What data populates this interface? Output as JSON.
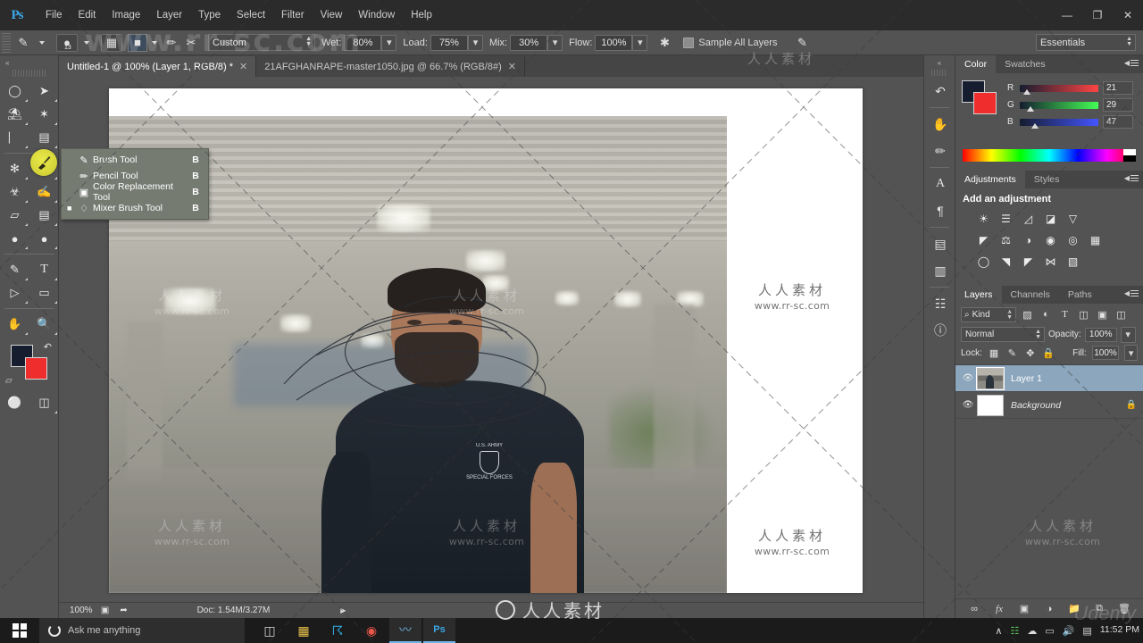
{
  "app": {
    "name": "Adobe Photoshop",
    "logo_text": "Ps",
    "workspace": "Essentials"
  },
  "menubar": {
    "items": [
      "File",
      "Edit",
      "Image",
      "Layer",
      "Type",
      "Select",
      "Filter",
      "View",
      "Window",
      "Help"
    ]
  },
  "window_controls": {
    "minimize": "—",
    "maximize": "❐",
    "close": "✕"
  },
  "options_bar": {
    "brush_size": "13",
    "preset_label": "Custom",
    "wet_label": "Wet:",
    "wet_value": "80%",
    "load_label": "Load:",
    "load_value": "75%",
    "mix_label": "Mix:",
    "mix_value": "30%",
    "flow_label": "Flow:",
    "flow_value": "100%",
    "sample_all_layers": "Sample All Layers"
  },
  "document_tabs": [
    {
      "title": "Untitled-1 @ 100% (Layer 1, RGB/8) *",
      "active": true,
      "close": "✕"
    },
    {
      "title": "21AFGHANRAPE-master1050.jpg @ 66.7% (RGB/8#)",
      "active": false,
      "close": "✕"
    }
  ],
  "tool_flyout": {
    "items": [
      {
        "label": "Brush Tool",
        "shortcut": "B",
        "selected": false
      },
      {
        "label": "Pencil Tool",
        "shortcut": "B",
        "selected": false
      },
      {
        "label": "Color Replacement Tool",
        "shortcut": "B",
        "selected": false
      },
      {
        "label": "Mixer Brush Tool",
        "shortcut": "B",
        "selected": true
      }
    ]
  },
  "toolbar": {
    "collapse": "«",
    "tools": [
      {
        "name": "elliptical-marquee-tool",
        "glyph": "◯"
      },
      {
        "name": "move-tool",
        "glyph": "➤"
      },
      {
        "name": "lasso-tool",
        "glyph": "⌇"
      },
      {
        "name": "magic-wand-tool",
        "glyph": "✦"
      },
      {
        "name": "crop-tool",
        "glyph": "⌸"
      },
      {
        "name": "eyedropper-tool",
        "glyph": "⚖"
      },
      {
        "name": "spot-healing-brush-tool",
        "glyph": "✻"
      },
      {
        "name": "brush-tool",
        "glyph": "✐"
      },
      {
        "name": "clone-stamp-tool",
        "glyph": "⛃"
      },
      {
        "name": "history-brush-tool",
        "glyph": "✎"
      },
      {
        "name": "eraser-tool",
        "glyph": "▱"
      },
      {
        "name": "gradient-tool",
        "glyph": "▤"
      },
      {
        "name": "blur-tool",
        "glyph": "●"
      },
      {
        "name": "dodge-tool",
        "glyph": "◐"
      },
      {
        "name": "pen-tool",
        "glyph": "✒"
      },
      {
        "name": "type-tool",
        "glyph": "T"
      },
      {
        "name": "path-selection-tool",
        "glyph": "➤"
      },
      {
        "name": "rectangle-tool",
        "glyph": "▭"
      },
      {
        "name": "hand-tool",
        "glyph": "✋"
      },
      {
        "name": "zoom-tool",
        "glyph": "⚲"
      }
    ],
    "foreground_color": "#151d2f",
    "background_color": "#ef2d2d",
    "quick_mask": "⊚",
    "screen_mode": "▣"
  },
  "canvas": {
    "zoom": "100%",
    "doc_info": "Doc: 1.54M/3.27M",
    "status_arrow": "▶"
  },
  "icon_rail": {
    "collapse": "«",
    "icons": [
      {
        "name": "history-panel-icon",
        "glyph": "↺"
      },
      {
        "name": "brush-presets-icon",
        "glyph": "⚒"
      },
      {
        "name": "brush-panel-icon",
        "glyph": "✏"
      },
      {
        "name": "character-panel-icon",
        "glyph": "A"
      },
      {
        "name": "paragraph-panel-icon",
        "glyph": "¶"
      },
      {
        "name": "libraries-panel-icon",
        "glyph": "▤"
      },
      {
        "name": "notes-panel-icon",
        "glyph": "▥"
      },
      {
        "name": "properties-panel-icon",
        "glyph": "☷"
      },
      {
        "name": "info-panel-icon",
        "glyph": "ⓘ"
      }
    ]
  },
  "color_panel": {
    "tabs": [
      {
        "label": "Color",
        "active": true
      },
      {
        "label": "Swatches",
        "active": false
      }
    ],
    "channels": [
      {
        "label": "R",
        "value": "21",
        "pct": 8
      },
      {
        "label": "G",
        "value": "29",
        "pct": 11
      },
      {
        "label": "B",
        "value": "47",
        "pct": 18
      }
    ],
    "foreground": "#151d2f",
    "background": "#ef2d2d"
  },
  "adjustments_panel": {
    "tabs": [
      {
        "label": "Adjustments",
        "active": true
      },
      {
        "label": "Styles",
        "active": false
      }
    ],
    "heading": "Add an adjustment",
    "rows": [
      [
        {
          "name": "brightness-contrast-icon",
          "glyph": "☀"
        },
        {
          "name": "levels-icon",
          "glyph": "ᵛ"
        },
        {
          "name": "curves-icon",
          "glyph": "⌐"
        },
        {
          "name": "exposure-icon",
          "glyph": "◨"
        },
        {
          "name": "vibrance-icon",
          "glyph": "▽"
        }
      ],
      [
        {
          "name": "hue-saturation-icon",
          "glyph": "◰"
        },
        {
          "name": "color-balance-icon",
          "glyph": "⚖"
        },
        {
          "name": "black-white-icon",
          "glyph": "◑"
        },
        {
          "name": "photo-filter-icon",
          "glyph": "❀"
        },
        {
          "name": "channel-mixer-icon",
          "glyph": "◎"
        },
        {
          "name": "color-lookup-icon",
          "glyph": "▦"
        }
      ],
      [
        {
          "name": "invert-icon",
          "glyph": "◧"
        },
        {
          "name": "posterize-icon",
          "glyph": "◥"
        },
        {
          "name": "threshold-icon",
          "glyph": "◤"
        },
        {
          "name": "selective-color-icon",
          "glyph": "⋈"
        },
        {
          "name": "gradient-map-icon",
          "glyph": "▧"
        }
      ]
    ]
  },
  "layers_panel": {
    "tabs": [
      {
        "label": "Layers",
        "active": true
      },
      {
        "label": "Channels",
        "active": false
      },
      {
        "label": "Paths",
        "active": false
      }
    ],
    "filter_label": "Kind",
    "filter_icons": [
      {
        "name": "filter-pixel-icon",
        "glyph": "▨"
      },
      {
        "name": "filter-adjustment-icon",
        "glyph": "◐"
      },
      {
        "name": "filter-type-icon",
        "glyph": "T"
      },
      {
        "name": "filter-shape-icon",
        "glyph": "◫"
      },
      {
        "name": "filter-smart-object-icon",
        "glyph": "❐"
      }
    ],
    "blend_mode": "Normal",
    "opacity_label": "Opacity:",
    "opacity_value": "100%",
    "lock_label": "Lock:",
    "lock_icons": [
      {
        "name": "lock-transparent-pixels-icon",
        "glyph": "▒"
      },
      {
        "name": "lock-image-pixels-icon",
        "glyph": "✐"
      },
      {
        "name": "lock-position-icon",
        "glyph": "✥"
      },
      {
        "name": "lock-all-icon",
        "glyph": "ὑ2"
      }
    ],
    "fill_label": "Fill:",
    "fill_value": "100%",
    "layers": [
      {
        "name": "Layer 1",
        "selected": true,
        "visible": true,
        "locked": false,
        "thumb": "image"
      },
      {
        "name": "Background",
        "selected": false,
        "visible": true,
        "locked": true,
        "thumb": "white"
      }
    ],
    "footer_icons": [
      {
        "name": "link-layers-icon",
        "glyph": "⚭"
      },
      {
        "name": "layer-style-icon",
        "glyph": "fx"
      },
      {
        "name": "layer-mask-icon",
        "glyph": "▣"
      },
      {
        "name": "new-adjustment-layer-icon",
        "glyph": "◑"
      },
      {
        "name": "new-group-icon",
        "glyph": "▱"
      },
      {
        "name": "new-layer-icon",
        "glyph": "⧉"
      },
      {
        "name": "delete-layer-icon",
        "glyph": "Ὕ1"
      }
    ]
  },
  "taskbar": {
    "search_placeholder": "Ask me anything",
    "apps": [
      {
        "name": "taskview-icon",
        "glyph": "▣",
        "running": false
      },
      {
        "name": "store-icon",
        "glyph": "▦",
        "running": false
      },
      {
        "name": "skype-icon",
        "glyph": "Ⓢ",
        "running": false
      },
      {
        "name": "chrome-icon",
        "glyph": "◉",
        "running": false
      },
      {
        "name": "audacity-icon",
        "glyph": "〰",
        "running": true
      },
      {
        "name": "photoshop-icon",
        "glyph": "Ps",
        "running": true
      }
    ],
    "tray": [
      {
        "name": "show-hidden-icons",
        "glyph": "∧"
      },
      {
        "name": "network-icon",
        "glyph": "☷"
      },
      {
        "name": "onedrive-icon",
        "glyph": "☁"
      },
      {
        "name": "display-icon",
        "glyph": "▭"
      },
      {
        "name": "volume-icon",
        "glyph": "ὐa"
      },
      {
        "name": "action-center-icon",
        "glyph": "▤"
      }
    ],
    "clock": "11:52 PM"
  },
  "watermark": {
    "cn": "人人素材",
    "url": "www.rr-sc.com",
    "udemy": "Udemy"
  }
}
